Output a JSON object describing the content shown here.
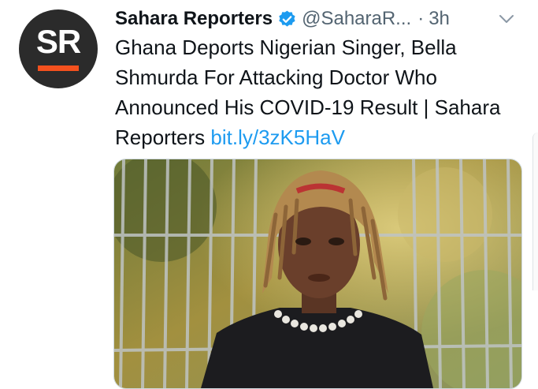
{
  "avatar": {
    "initials": "SR",
    "bg_color": "#2b2b2b",
    "accent_color": "#f4511e"
  },
  "header": {
    "display_name": "Sahara Reporters",
    "handle": "@SaharaR...",
    "separator": "·",
    "time": "3h",
    "verified_icon": "verified-badge-icon",
    "menu_icon": "chevron-down-icon"
  },
  "tweet": {
    "text": "Ghana Deports Nigerian Singer, Bella Shmurda For Attacking Doctor Who Announced His COVID-19 Result | Sahara Reporters ",
    "link": "bit.ly/3zK5HaV",
    "link_color": "#1d9bf0"
  },
  "media": {
    "type": "photo"
  }
}
